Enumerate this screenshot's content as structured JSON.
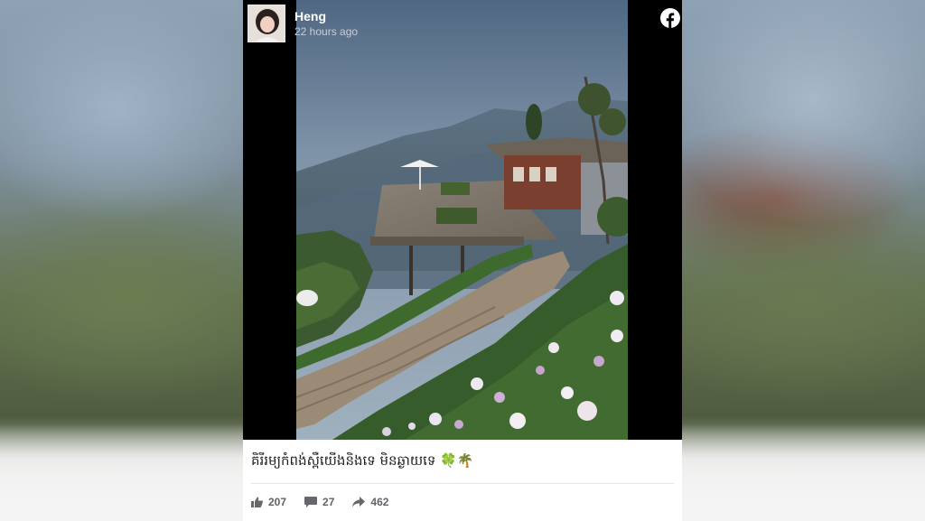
{
  "post": {
    "author": "Heng",
    "time": "22 hours ago",
    "caption": "គិរីរម្យកំពង់ស្ពឺយើងនិងទេ មិនឆ្ងាយទេ 🍀🌴",
    "stats": {
      "likes": "207",
      "comments": "27",
      "shares": "462"
    }
  },
  "icons": {
    "brand": "facebook-icon",
    "like": "thumbs-up-icon",
    "comment": "comment-icon",
    "share": "share-arrow-icon"
  },
  "colors": {
    "facebook_brand": "#ffffff",
    "media_background": "#000000",
    "stat_text": "#5f6368"
  }
}
